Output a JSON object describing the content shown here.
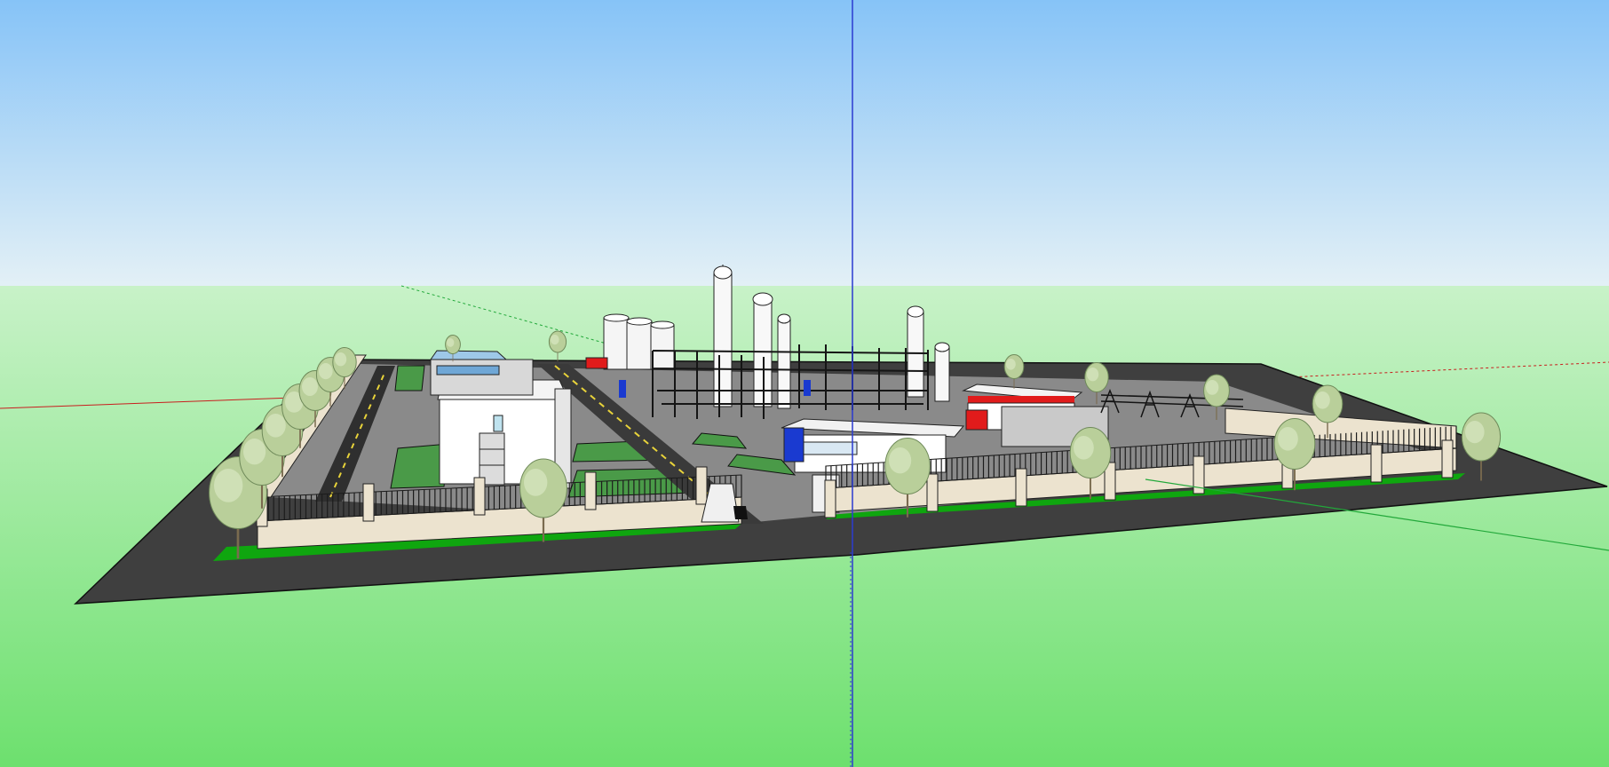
{
  "viewport": {
    "sky_top": "#86c3f7",
    "sky_horizon": "#e3f0f6",
    "ground_top": "#c8f2c8",
    "ground_bottom": "#6de06e",
    "asphalt": "#3f3f3f",
    "grass": "#0fa60f",
    "wall": "#ece3cf",
    "fence": "#1c1c1c",
    "tree": "#b9cf9a",
    "building": "#ffffff",
    "accent_red": "#e11b1b",
    "accent_blue": "#1a3ad0"
  },
  "axes": {
    "blue_axis_color": "#2b3bd0",
    "red_axis_color": "#c81e1e",
    "green_axis_color": "#22a83a"
  }
}
